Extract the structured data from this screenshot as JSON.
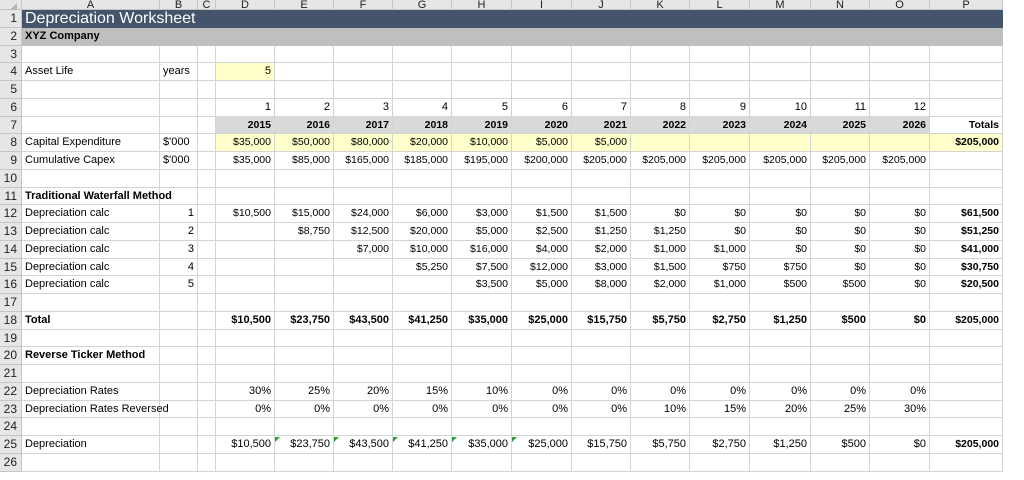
{
  "columns": [
    "A",
    "B",
    "C",
    "D",
    "E",
    "F",
    "G",
    "H",
    "I",
    "J",
    "K",
    "L",
    "M",
    "N",
    "O",
    "P"
  ],
  "rows": [
    1,
    2,
    3,
    4,
    5,
    6,
    7,
    8,
    9,
    10,
    11,
    12,
    13,
    14,
    15,
    16,
    17,
    18,
    19,
    20,
    21,
    22,
    23,
    24,
    25,
    26
  ],
  "title": "Depreciation Worksheet",
  "company": "XYZ Company",
  "asset_life": {
    "label": "Asset Life",
    "unit": "years",
    "value": "5"
  },
  "periods": [
    "1",
    "2",
    "3",
    "4",
    "5",
    "6",
    "7",
    "8",
    "9",
    "10",
    "11",
    "12"
  ],
  "years": [
    "2015",
    "2016",
    "2017",
    "2018",
    "2019",
    "2020",
    "2021",
    "2022",
    "2023",
    "2024",
    "2025",
    "2026"
  ],
  "totals_header": "Totals",
  "capex": {
    "label": "Capital Expenditure",
    "unit": "$'000",
    "values": [
      "$35,000",
      "$50,000",
      "$80,000",
      "$20,000",
      "$10,000",
      "$5,000",
      "$5,000",
      "",
      "",
      "",
      "",
      ""
    ],
    "total": "$205,000"
  },
  "cum_capex": {
    "label": "Cumulative Capex",
    "unit": "$'000",
    "values": [
      "$35,000",
      "$85,000",
      "$165,000",
      "$185,000",
      "$195,000",
      "$200,000",
      "$205,000",
      "$205,000",
      "$205,000",
      "$205,000",
      "$205,000",
      "$205,000"
    ],
    "total": ""
  },
  "waterfall": {
    "heading": "Traditional Waterfall Method",
    "rows": [
      {
        "label": "Depreciation calc",
        "n": "1",
        "values": [
          "$10,500",
          "$15,000",
          "$24,000",
          "$6,000",
          "$3,000",
          "$1,500",
          "$1,500",
          "$0",
          "$0",
          "$0",
          "$0",
          "$0"
        ],
        "total": "$61,500"
      },
      {
        "label": "Depreciation calc",
        "n": "2",
        "values": [
          "",
          "$8,750",
          "$12,500",
          "$20,000",
          "$5,000",
          "$2,500",
          "$1,250",
          "$1,250",
          "$0",
          "$0",
          "$0",
          "$0"
        ],
        "total": "$51,250"
      },
      {
        "label": "Depreciation calc",
        "n": "3",
        "values": [
          "",
          "",
          "$7,000",
          "$10,000",
          "$16,000",
          "$4,000",
          "$2,000",
          "$1,000",
          "$1,000",
          "$0",
          "$0",
          "$0"
        ],
        "total": "$41,000"
      },
      {
        "label": "Depreciation calc",
        "n": "4",
        "values": [
          "",
          "",
          "",
          "$5,250",
          "$7,500",
          "$12,000",
          "$3,000",
          "$1,500",
          "$750",
          "$750",
          "$0",
          "$0"
        ],
        "total": "$30,750"
      },
      {
        "label": "Depreciation calc",
        "n": "5",
        "values": [
          "",
          "",
          "",
          "",
          "$3,500",
          "$5,000",
          "$8,000",
          "$2,000",
          "$1,000",
          "$500",
          "$500",
          "$0"
        ],
        "total": "$20,500"
      }
    ]
  },
  "total_row": {
    "label": "Total",
    "values": [
      "$10,500",
      "$23,750",
      "$43,500",
      "$41,250",
      "$35,000",
      "$25,000",
      "$15,750",
      "$5,750",
      "$2,750",
      "$1,250",
      "$500",
      "$0"
    ],
    "total": "$205,000"
  },
  "reverse": {
    "heading": "Reverse Ticker Method"
  },
  "rates": {
    "label": "Depreciation Rates",
    "values": [
      "30%",
      "25%",
      "20%",
      "15%",
      "10%",
      "0%",
      "0%",
      "0%",
      "0%",
      "0%",
      "0%",
      "0%"
    ]
  },
  "rates_rev": {
    "label": "Depreciation Rates Reversed",
    "values": [
      "0%",
      "0%",
      "0%",
      "0%",
      "0%",
      "0%",
      "0%",
      "10%",
      "15%",
      "20%",
      "25%",
      "30%"
    ]
  },
  "depreciation": {
    "label": "Depreciation",
    "values": [
      "$10,500",
      "$23,750",
      "$43,500",
      "$41,250",
      "$35,000",
      "$25,000",
      "$15,750",
      "$5,750",
      "$2,750",
      "$1,250",
      "$500",
      "$0"
    ],
    "total": "$205,000"
  },
  "colors": {
    "title_bar": "#44546a",
    "company_bar": "#bfbfbf",
    "input_fill": "#ffffcc",
    "year_fill": "#d9d9d9",
    "error_flag": "#2e9e3a"
  }
}
